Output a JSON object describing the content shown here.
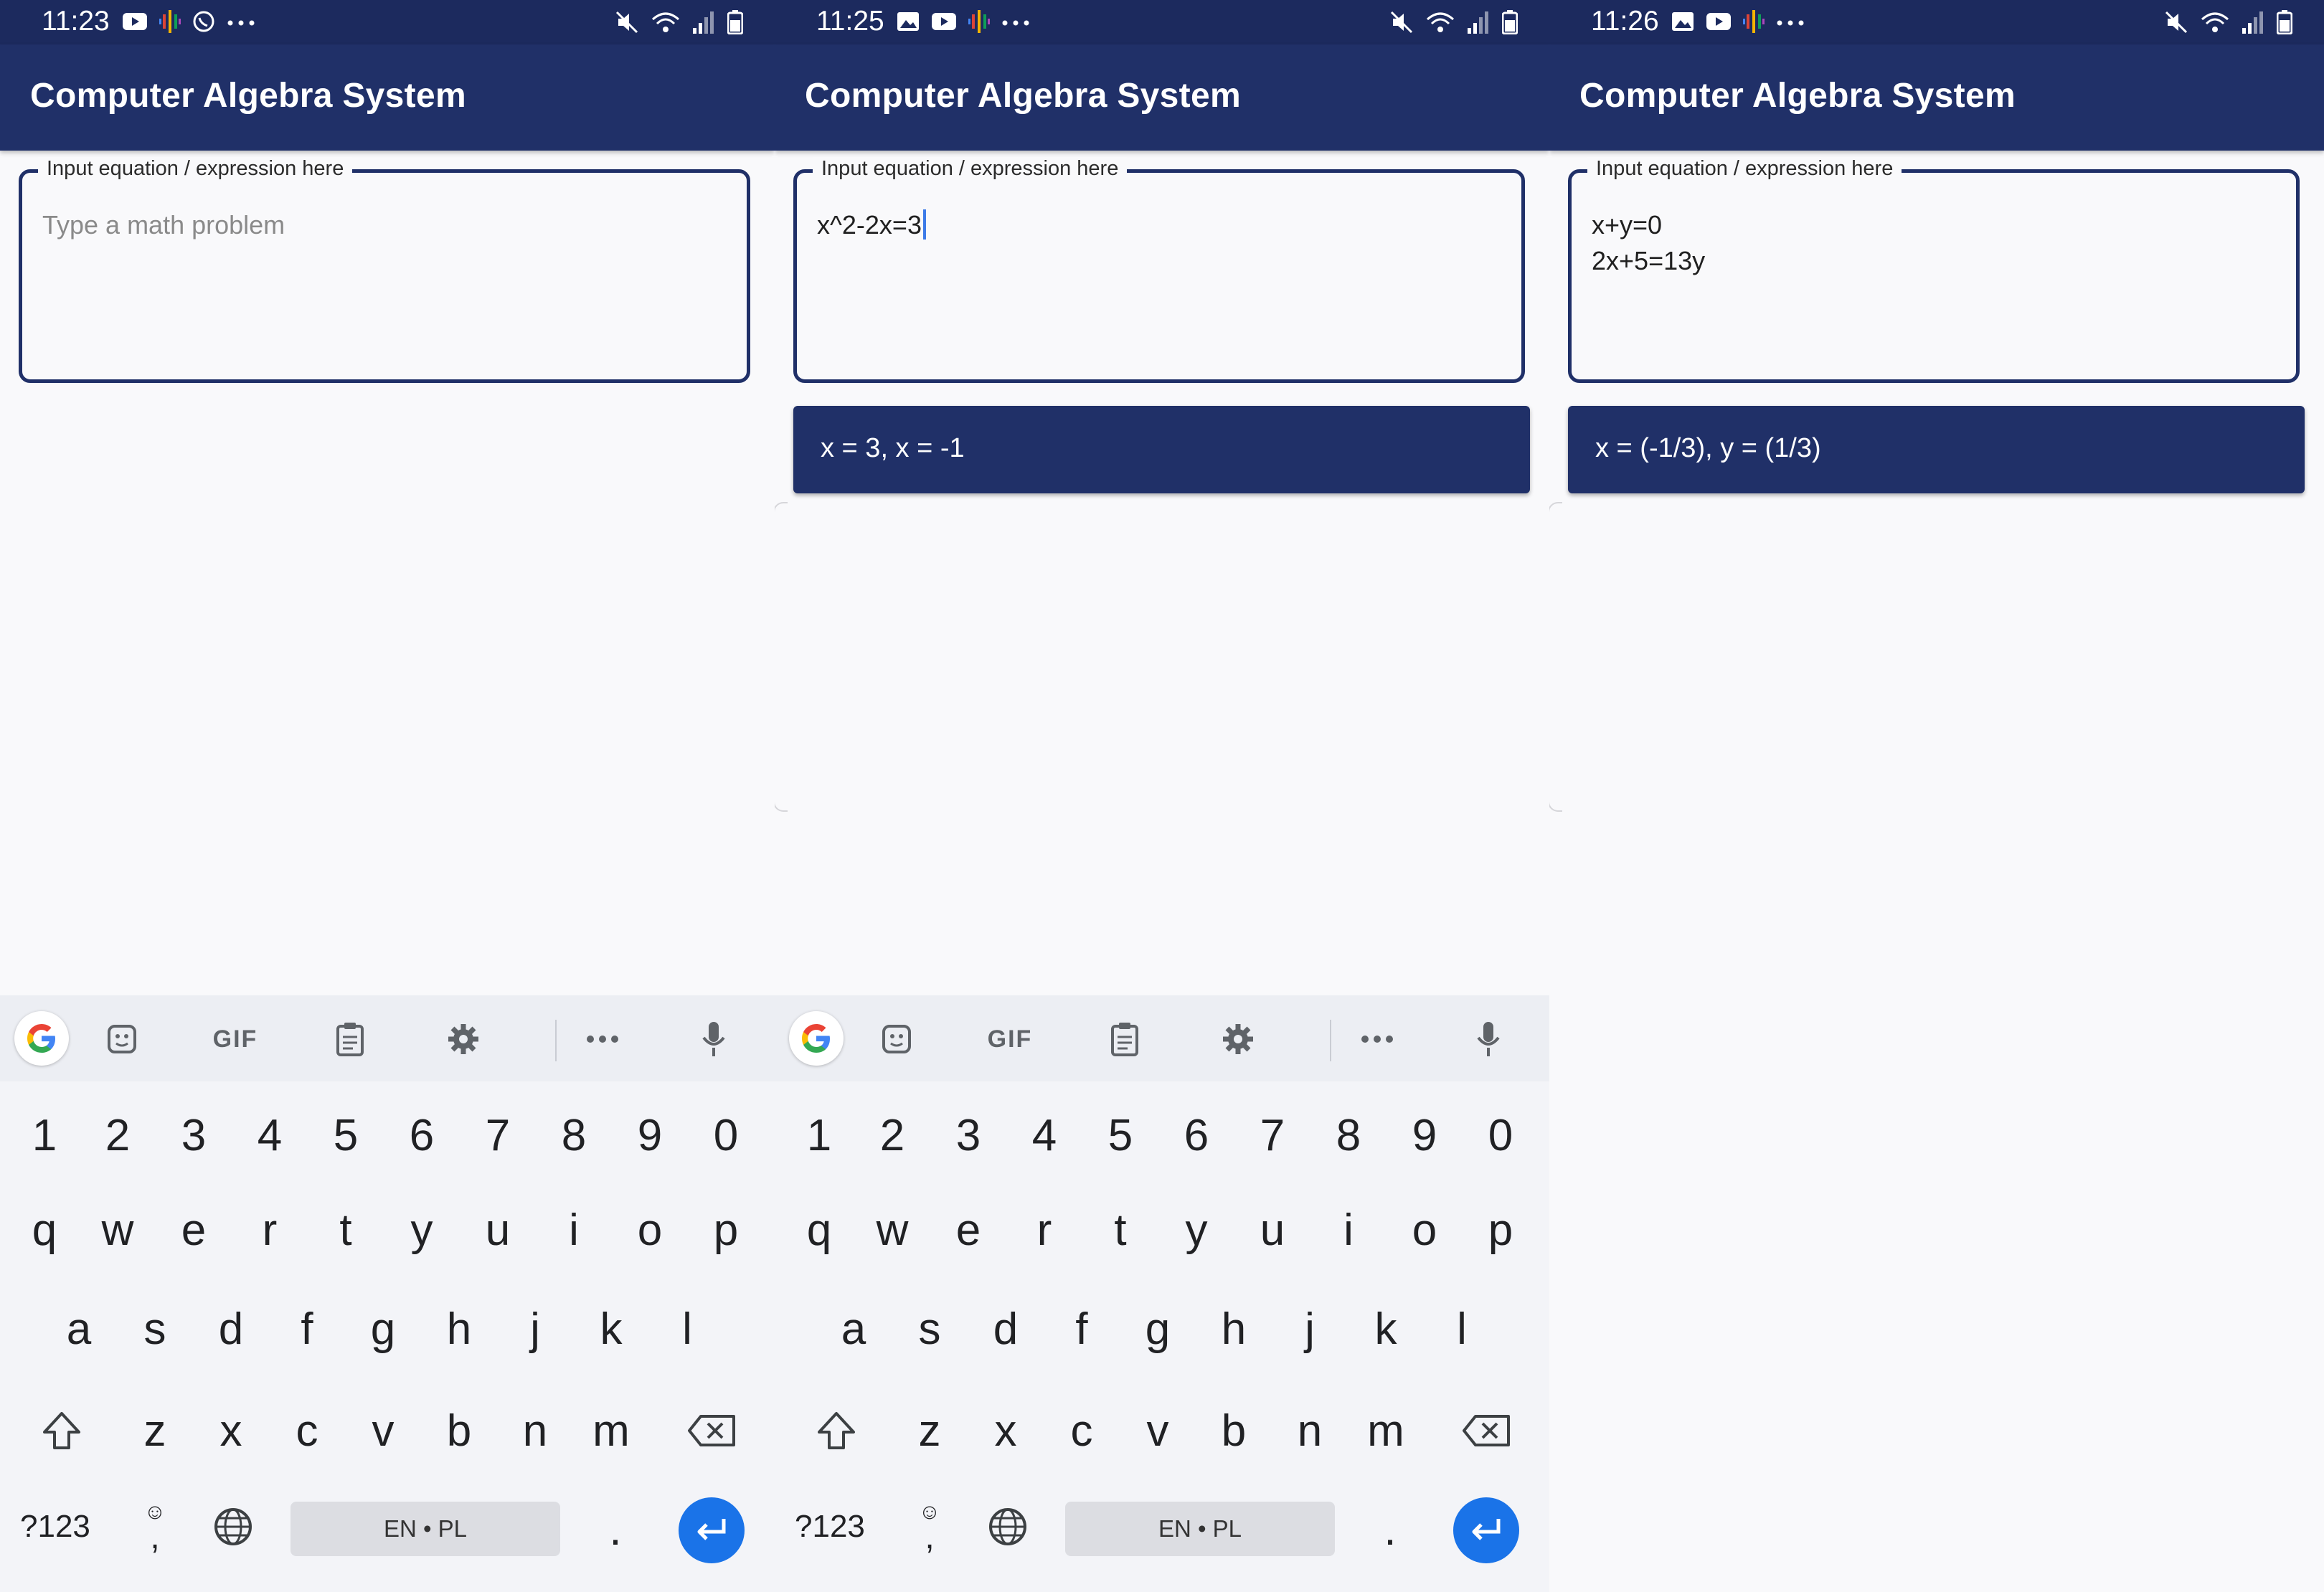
{
  "app_title": "Computer Algebra System",
  "field_label": "Input equation / expression here",
  "field_placeholder": "Type a math problem",
  "panels": [
    {
      "time": "11:23",
      "input_value": "",
      "result": null,
      "keyboard_visible": true
    },
    {
      "time": "11:25",
      "input_value": "x^2-2x=3",
      "result": "x = 3, x = -1",
      "keyboard_visible": true
    },
    {
      "time": "11:26",
      "input_value": "x+y=0\n2x+5=13y",
      "result": "x = (-1/3), y = (1/3)",
      "keyboard_visible": false
    }
  ],
  "keyboard": {
    "toolbar": [
      "google-icon",
      "sticker-icon",
      "GIF",
      "clipboard-icon",
      "gear-icon",
      "more-icon",
      "mic-icon"
    ],
    "numbers": [
      "1",
      "2",
      "3",
      "4",
      "5",
      "6",
      "7",
      "8",
      "9",
      "0"
    ],
    "row1": [
      "q",
      "w",
      "e",
      "r",
      "t",
      "y",
      "u",
      "i",
      "o",
      "p"
    ],
    "row2": [
      "a",
      "s",
      "d",
      "f",
      "g",
      "h",
      "j",
      "k",
      "l"
    ],
    "row3": [
      "z",
      "x",
      "c",
      "v",
      "b",
      "n",
      "m"
    ],
    "sym_label": "?123",
    "comma": ",",
    "space_label": "EN • PL",
    "period": "."
  },
  "colors": {
    "primary": "#203068",
    "status_bar": "#1c2a5e",
    "enter": "#1a73e8"
  }
}
